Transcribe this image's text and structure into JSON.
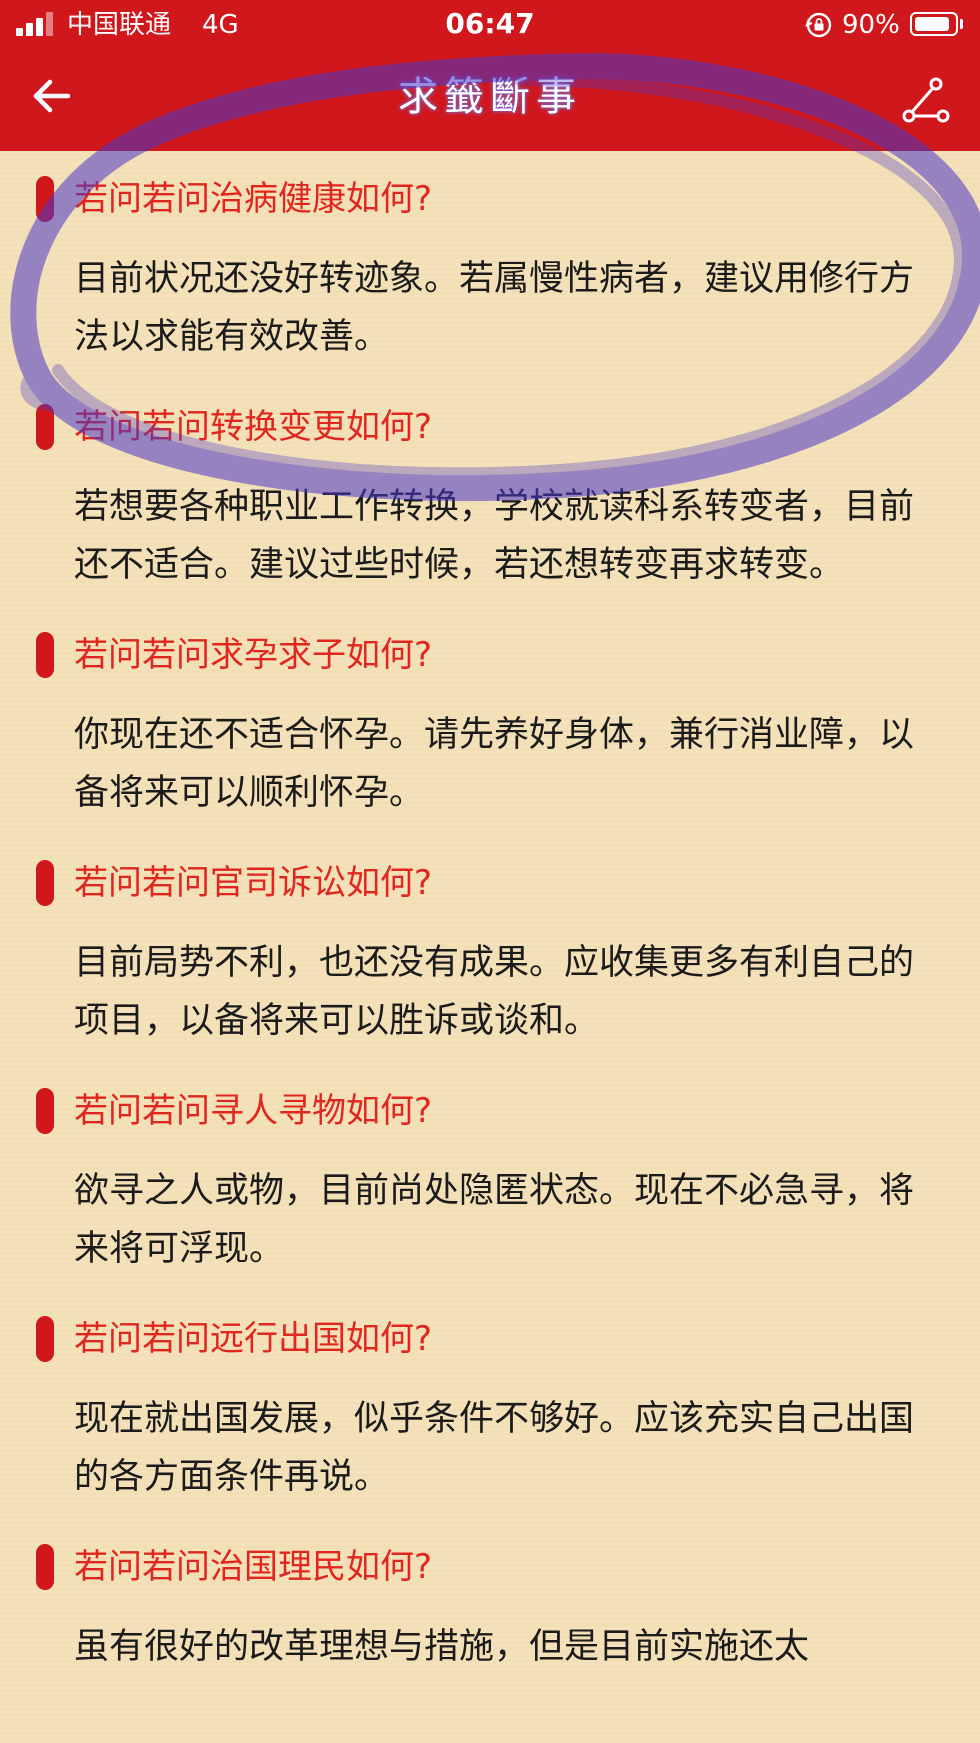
{
  "status_bar": {
    "carrier": "中国联通",
    "network": "4G",
    "time": "06:47",
    "battery_percent": "90%",
    "battery_level": 0.9
  },
  "header": {
    "title": "求籤斷事"
  },
  "entries": [
    {
      "question": "若问若问治病健康如何?",
      "answer": "目前状况还没好转迹象。若属慢性病者，建议用修行方法以求能有效改善。"
    },
    {
      "question": "若问若问转换变更如何?",
      "answer": "若想要各种职业工作转换，学校就读科系转变者，目前还不适合。建议过些时候，若还想转变再求转变。"
    },
    {
      "question": "若问若问求孕求子如何?",
      "answer": "你现在还不适合怀孕。请先养好身体，兼行消业障，以备将来可以顺利怀孕。"
    },
    {
      "question": "若问若问官司诉讼如何?",
      "answer": "目前局势不利，也还没有成果。应收集更多有利自己的项目，以备将来可以胜诉或谈和。"
    },
    {
      "question": "若问若问寻人寻物如何?",
      "answer": "欲寻之人或物，目前尚处隐匿状态。现在不必急寻，将来将可浮现。"
    },
    {
      "question": "若问若问远行出国如何?",
      "answer": "现在就出国发展，似乎条件不够好。应该充实自己出国的各方面条件再说。"
    },
    {
      "question": "若问若问治国理民如何?",
      "answer": "虽有很好的改革理想与措施，但是目前实施还太"
    }
  ],
  "colors": {
    "header_bg": "#d0171c",
    "page_bg": "#f3dfb5",
    "question_text": "#e0261e",
    "answer_text": "#1b1b1b",
    "annotation_ink": "#4a37c8"
  },
  "icons": {
    "back": "arrow-left-icon",
    "share": "share-nodes-icon",
    "lock": "orientation-lock-icon"
  }
}
